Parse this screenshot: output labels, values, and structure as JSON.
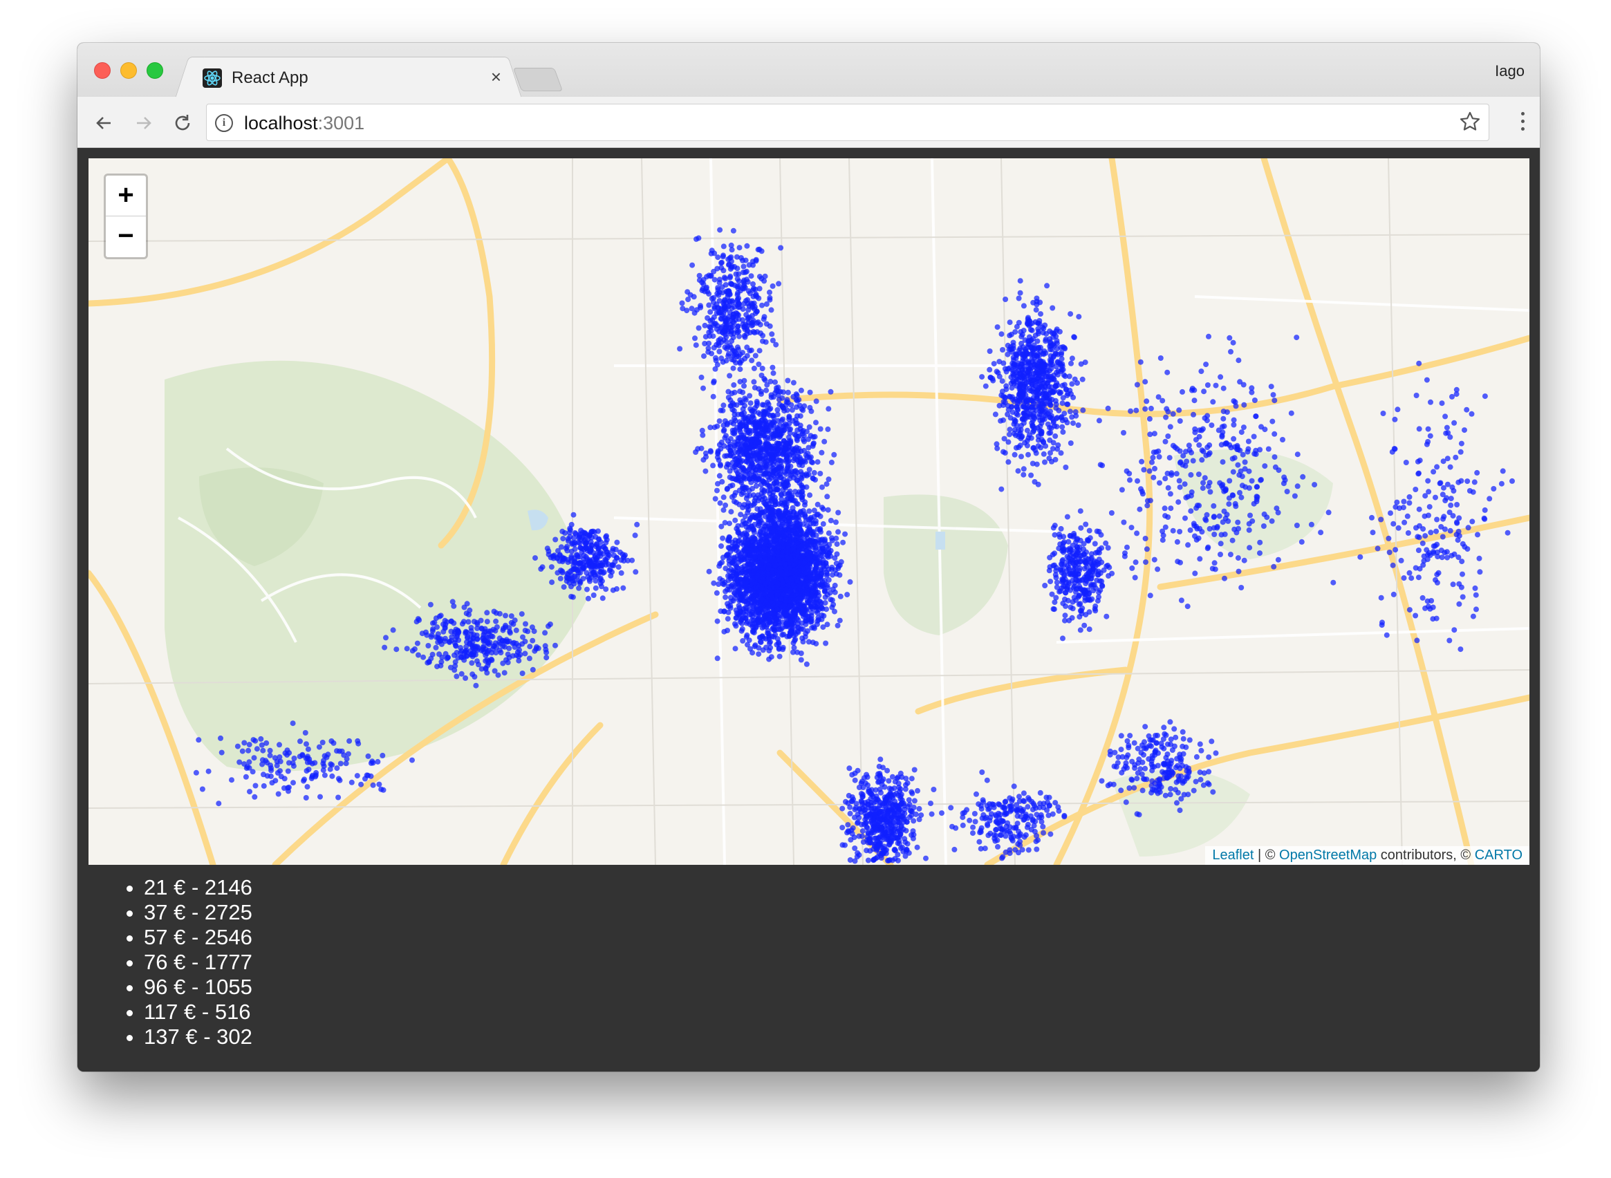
{
  "browser": {
    "tab_title": "React App",
    "tab_close": "×",
    "profile_name": "Iago",
    "url_host": "localhost",
    "url_port": ":3001"
  },
  "map": {
    "zoom_in": "+",
    "zoom_out": "−",
    "attribution": {
      "leaflet": "Leaflet",
      "sep1": " | © ",
      "osm": "OpenStreetMap",
      "contributors": " contributors, © ",
      "carto": "CARTO"
    },
    "point_color": "#1020ff",
    "link_color": "#0078a8"
  },
  "price_buckets": [
    {
      "label": "21 € - 2146"
    },
    {
      "label": "37 € - 2725"
    },
    {
      "label": "57 € - 2546"
    },
    {
      "label": "76 € - 1777"
    },
    {
      "label": "96 € - 1055"
    },
    {
      "label": "117 € - 516"
    },
    {
      "label": "137 € - 302"
    }
  ]
}
